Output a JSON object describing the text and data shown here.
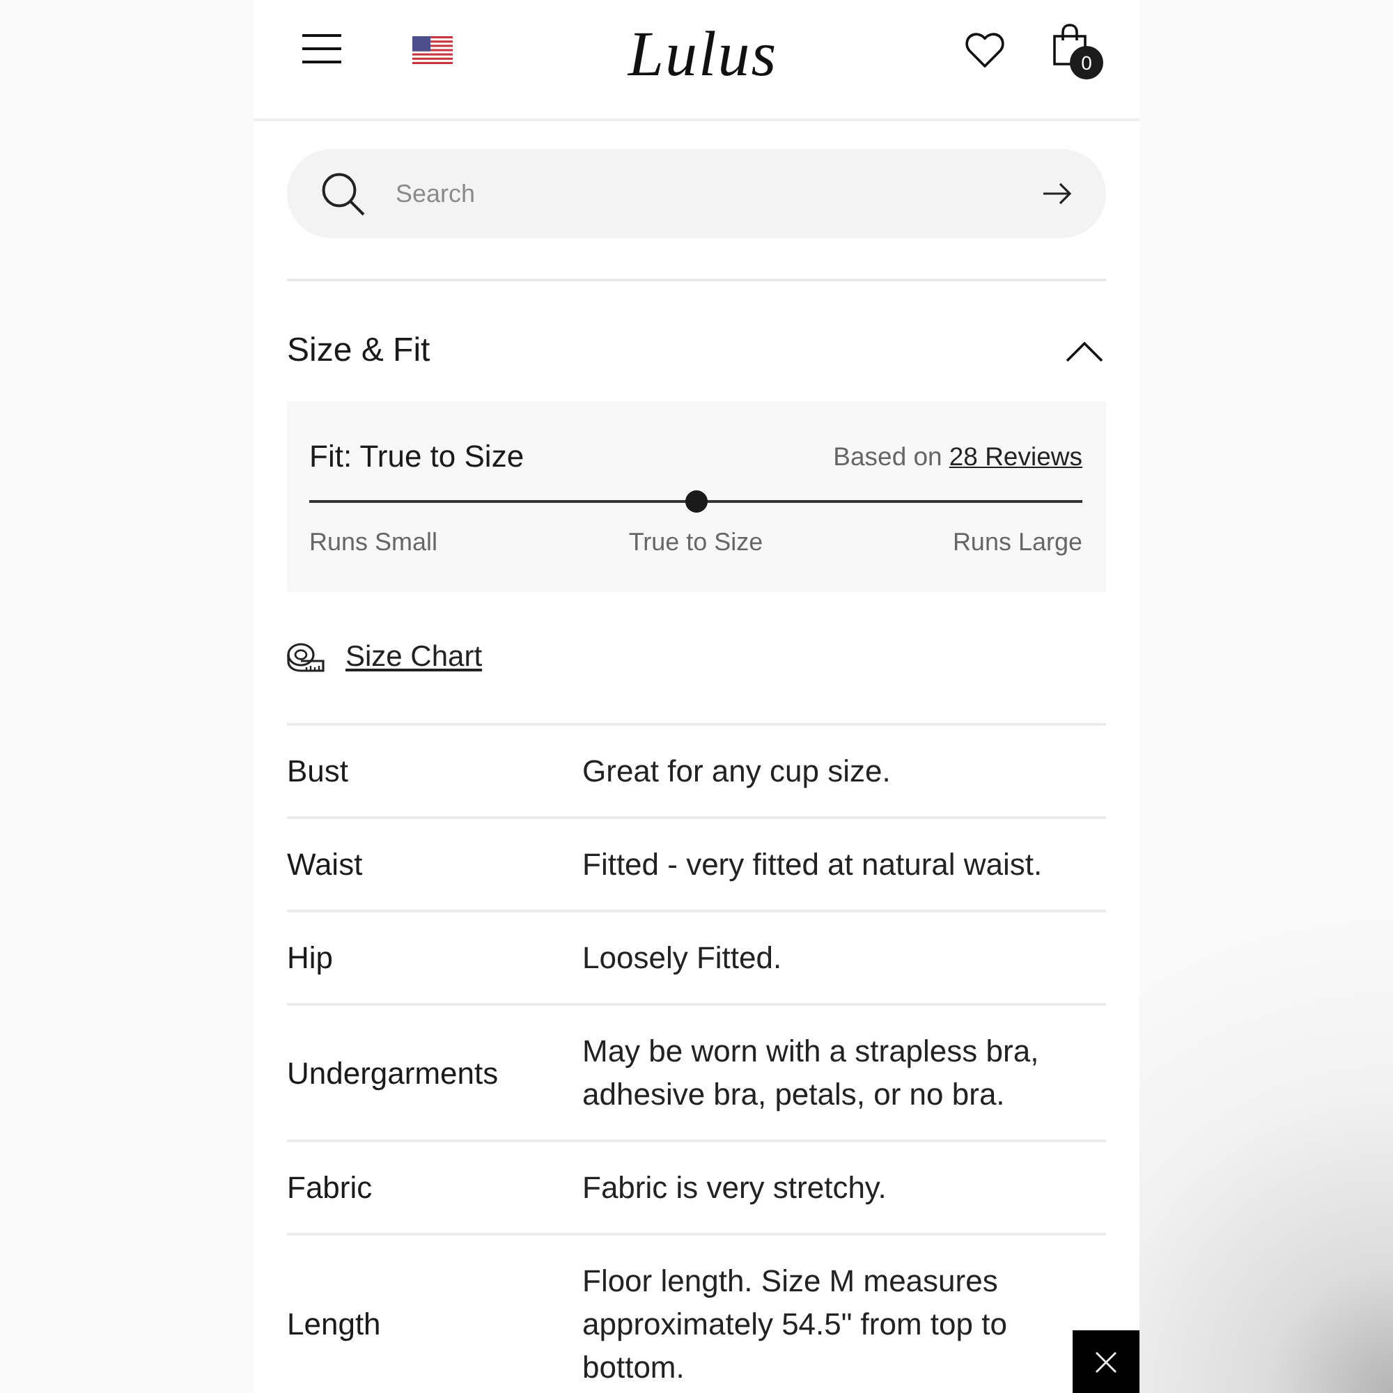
{
  "header": {
    "logo": "Lulus",
    "cart_count": "0"
  },
  "search": {
    "placeholder": "Search"
  },
  "size_fit": {
    "title": "Size & Fit",
    "expanded": true,
    "fit": {
      "title": "Fit: True to Size",
      "based_on": "Based on",
      "reviews_link": "28 Reviews",
      "level": 0.5,
      "scale_labels": [
        "Runs Small",
        "True to Size",
        "Runs Large"
      ]
    },
    "size_chart_link": "Size Chart",
    "details": [
      {
        "label": "Bust",
        "value": "Great for any cup size."
      },
      {
        "label": "Waist",
        "value": "Fitted - very fitted at natural waist."
      },
      {
        "label": "Hip",
        "value": "Loosely Fitted."
      },
      {
        "label": "Undergarments",
        "value": "May be worn with a strapless bra, adhesive bra, petals, or no bra."
      },
      {
        "label": "Fabric",
        "value": "Fabric is very stretchy."
      },
      {
        "label": "Length",
        "value": "Floor length. Size M measures approximately 54.5\" from top to bottom."
      }
    ]
  }
}
